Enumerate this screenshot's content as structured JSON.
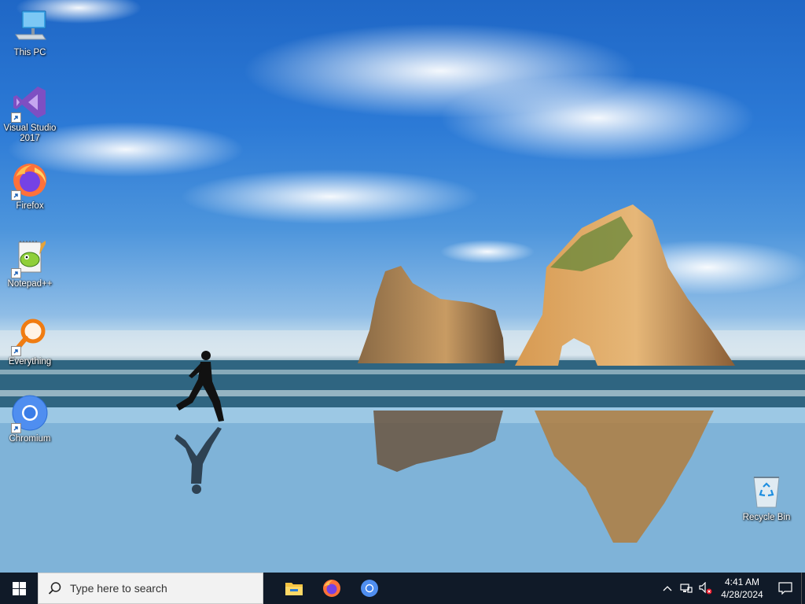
{
  "desktop": {
    "icons": [
      {
        "label": "This PC"
      },
      {
        "label": "Visual Studio 2017"
      },
      {
        "label": "Firefox"
      },
      {
        "label": "Notepad++"
      },
      {
        "label": "Everything"
      },
      {
        "label": "Chromium"
      },
      {
        "label": "Recycle Bin"
      }
    ]
  },
  "taskbar": {
    "search_placeholder": "Type here to search",
    "apps": [
      "file-explorer-icon",
      "firefox-icon",
      "chromium-icon"
    ],
    "clock_time": "4:41 AM",
    "clock_date": "4/28/2024"
  },
  "colors": {
    "taskbar_bg": "#101a28",
    "search_bg": "#f2f2f2",
    "sky_top": "#1f67c6"
  }
}
